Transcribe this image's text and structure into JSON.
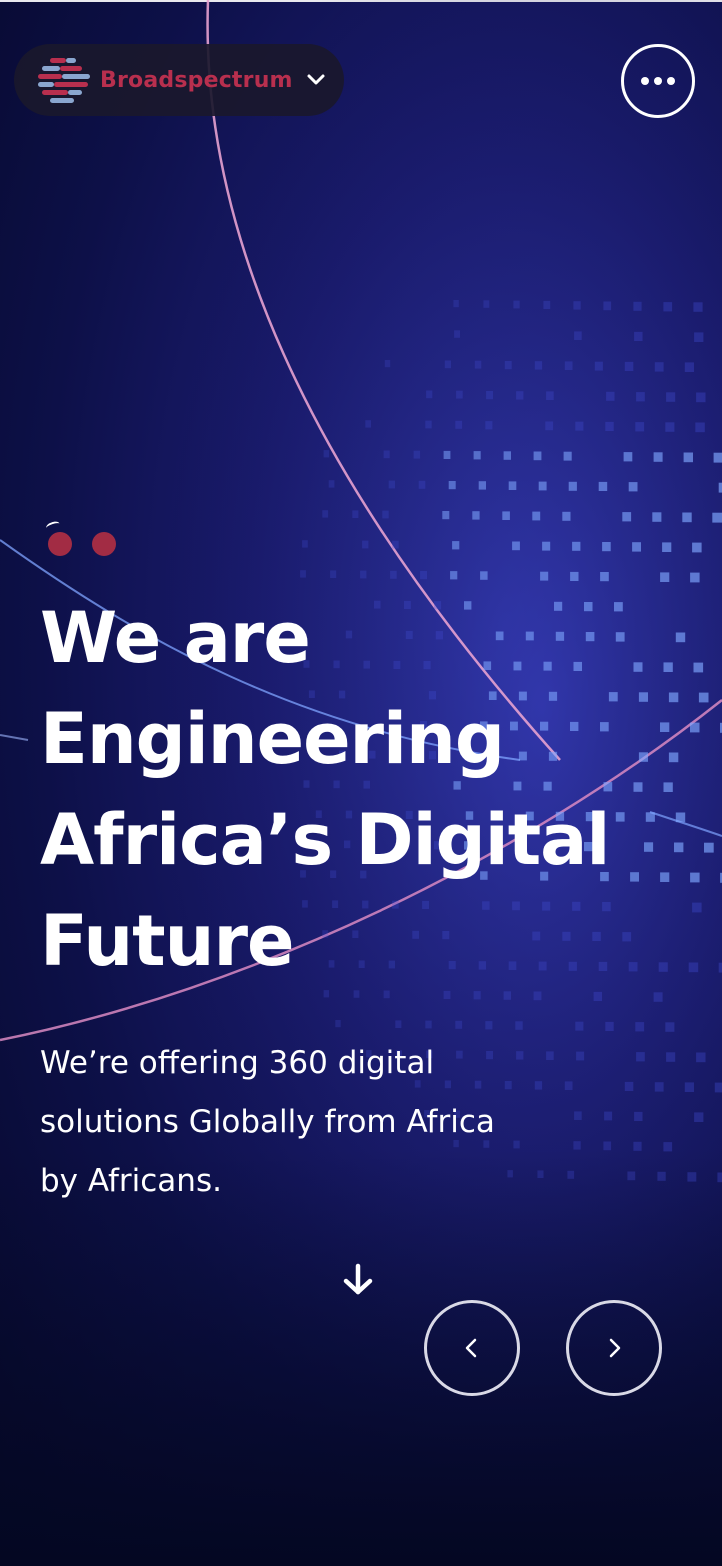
{
  "header": {
    "brand_name": "Broadspectrum",
    "brand_logo_icon": "broadspectrum-logo-icon",
    "dropdown_icon": "chevron-down-icon",
    "menu_icon": "more-horizontal-icon"
  },
  "hero": {
    "pager_dots": 2,
    "headline_lines": [
      "We are",
      "Engineering",
      "Africa’s Digital",
      "Future"
    ],
    "subtext_lines": [
      "We’re offering 360 digital",
      "solutions Globally from Africa",
      "by Africans."
    ],
    "scroll_icon": "arrow-down-icon"
  },
  "carousel": {
    "prev_icon": "chevron-left-icon",
    "next_icon": "chevron-right-icon"
  },
  "colors": {
    "brand_red": "#b82f4e",
    "pager_dot": "#a22c44",
    "background_deep": "#060828",
    "background_glow": "#2a2f9a",
    "text": "#ffffff"
  }
}
